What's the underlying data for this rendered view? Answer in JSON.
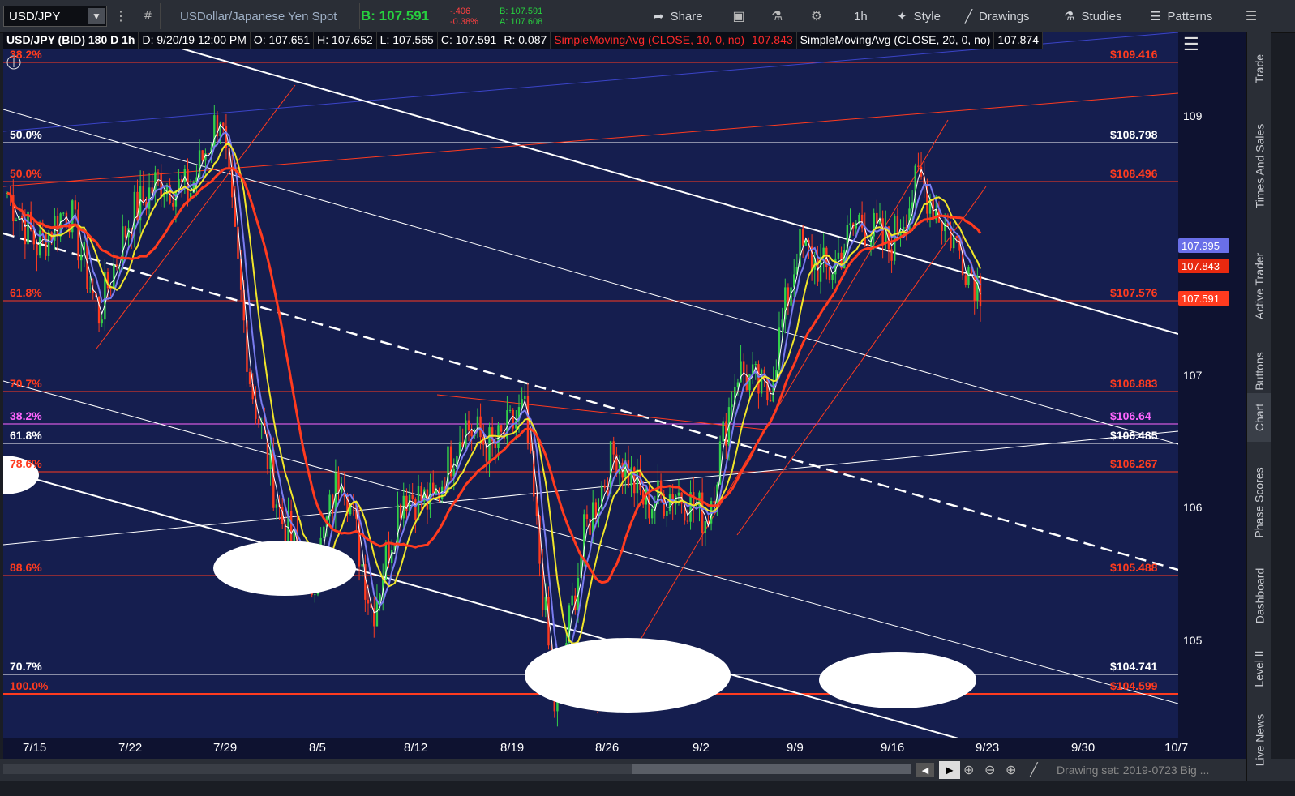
{
  "topbar": {
    "symbol": "USD/JPY",
    "description": "USDollar/Japanese Yen Spot",
    "bid": "B: 107.591",
    "change": "-.406",
    "change_pct": "-0.38%",
    "bid_small": "B: 107.591",
    "ask_small": "A: 107.608",
    "share": "Share",
    "timeframe": "1h",
    "style": "Style",
    "drawings": "Drawings",
    "studies": "Studies",
    "patterns": "Patterns"
  },
  "infobar": {
    "title": "USD/JPY (BID) 180 D 1h",
    "date": "D: 9/20/19 12:00 PM",
    "open": "O: 107.651",
    "high": "H: 107.652",
    "low": "L: 107.565",
    "close": "C: 107.591",
    "range": "R: 0.087",
    "ma1": "SimpleMovingAvg (CLOSE, 10, 0, no)",
    "ma1_val": "107.843",
    "ma2": "SimpleMovingAvg (CLOSE, 20, 0, no)",
    "ma2_val": "107.874"
  },
  "fib_left": [
    {
      "text": "38.2%",
      "color": "#ff3b1f"
    },
    {
      "text": "50.0%",
      "color": "#ffffff"
    },
    {
      "text": "50.0%",
      "color": "#ff3b1f"
    },
    {
      "text": "61.8%",
      "color": "#ff3b1f"
    },
    {
      "text": "70.7%",
      "color": "#ff3b1f"
    },
    {
      "text": "38.2%",
      "color": "#ff66ff"
    },
    {
      "text": "61.8%",
      "color": "#ffffff"
    },
    {
      "text": "78.6%",
      "color": "#ff3b1f"
    },
    {
      "text": "88.6%",
      "color": "#ff3b1f"
    },
    {
      "text": "70.7%",
      "color": "#ffffff"
    },
    {
      "text": "100.0%",
      "color": "#ff3b1f"
    }
  ],
  "fib_right": [
    {
      "text": "$109.416",
      "color": "#ff3b1f"
    },
    {
      "text": "$108.798",
      "color": "#ffffff"
    },
    {
      "text": "$108.496",
      "color": "#ff3b1f"
    },
    {
      "text": "$107.576",
      "color": "#ff3b1f"
    },
    {
      "text": "$106.883",
      "color": "#ff3b1f"
    },
    {
      "text": "$106.64",
      "color": "#ff66ff"
    },
    {
      "text": "$106.485",
      "color": "#ffffff"
    },
    {
      "text": "$106.267",
      "color": "#ff3b1f"
    },
    {
      "text": "$105.488",
      "color": "#ff3b1f"
    },
    {
      "text": "$104.741",
      "color": "#ffffff"
    },
    {
      "text": "$104.599",
      "color": "#ff3b1f"
    }
  ],
  "price_ticks": [
    "109",
    "107",
    "106",
    "105"
  ],
  "price_labels": [
    {
      "text": "107.995",
      "bg": "#6a6fe8",
      "fg": "#ffffff"
    },
    {
      "text": "107.843",
      "bg": "#e8290f",
      "fg": "#ffffff"
    },
    {
      "text": "107.591",
      "bg": "#ff3b1f",
      "fg": "#ffffff"
    }
  ],
  "date_ticks": [
    "7/15",
    "7/22",
    "7/29",
    "8/5",
    "8/12",
    "8/19",
    "8/26",
    "9/2",
    "9/9",
    "9/16",
    "9/23",
    "9/30",
    "10/7"
  ],
  "right_tabs": [
    "Trade",
    "Times And Sales",
    "Active Trader",
    "Big Buttons",
    "Chart",
    "Phase Scores",
    "Dashboard",
    "Level II",
    "Live News"
  ],
  "bottombar": {
    "drawing_set": "Drawing set: 2019-0723 Big ..."
  },
  "chart_data": {
    "type": "candlestick",
    "title": "USD/JPY (BID) 180 D 1h",
    "ylim": [
      104.4,
      109.6
    ],
    "x_ticks": [
      "7/15",
      "7/22",
      "7/29",
      "8/5",
      "8/12",
      "8/19",
      "8/26",
      "9/2",
      "9/9",
      "9/16",
      "9/23",
      "9/30",
      "10/7"
    ],
    "series": [
      {
        "name": "SimpleMovingAvg (CLOSE, 10, 0, no)",
        "last": 107.843
      },
      {
        "name": "SimpleMovingAvg (CLOSE, 20, 0, no)",
        "last": 107.874
      }
    ],
    "price_path": [
      108.3,
      107.9,
      108.2,
      107.4,
      108.1,
      108.4,
      108.3,
      108.9,
      106.9,
      105.9,
      105.4,
      106.3,
      105.2,
      106.1,
      106.0,
      106.6,
      106.4,
      106.7,
      104.5,
      105.8,
      106.4,
      106.0,
      106.1,
      105.9,
      107.0,
      106.8,
      107.9,
      107.7,
      108.1,
      107.9,
      108.4,
      108.0,
      107.6
    ]
  }
}
